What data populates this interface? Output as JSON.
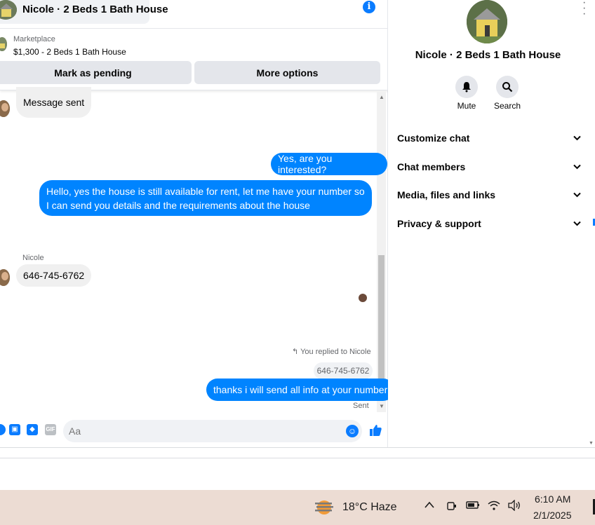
{
  "chat_header": {
    "title": "Nicole · 2 Beds 1 Bath House",
    "info_icon": "i"
  },
  "marketplace": {
    "label": "Marketplace",
    "listing": "$1,300 - 2 Beds 1 Bath House",
    "pending_button": "Mark as pending",
    "more_button": "More options"
  },
  "messages": {
    "m1": "Message sent",
    "m2": "Yes, are you interested?",
    "m3": "Hello, yes the house is still available for rent, let me have your number so I can send you details and the requirements about the house",
    "sender": "Nicole",
    "m4": "646-745-6762",
    "replied_label": "You replied to Nicole",
    "quoted": "646-745-6762",
    "m5": "thanks i will send all info at your number",
    "status": "Sent"
  },
  "composer": {
    "placeholder": "Aa",
    "gif_label": "GIF"
  },
  "info_panel": {
    "name": "Nicole · 2 Beds 1 Bath House",
    "mute_label": "Mute",
    "search_label": "Search",
    "sections": [
      "Customize chat",
      "Chat members",
      "Media, files and links",
      "Privacy & support"
    ]
  },
  "taskbar": {
    "weather": "18°C  Haze",
    "time": "6:10 AM",
    "date": "2/1/2025"
  },
  "colors": {
    "accent": "#0084ff",
    "bubble_in": "#f0f0f0",
    "taskbar": "#ecdcd3"
  },
  "icons": [
    "info-icon",
    "bell-icon",
    "search-icon",
    "chevron-down-icon",
    "image-icon",
    "sticker-icon",
    "gif-icon",
    "emoji-icon",
    "like-icon",
    "weather-icon",
    "wifi-icon",
    "volume-icon",
    "battery-icon"
  ]
}
